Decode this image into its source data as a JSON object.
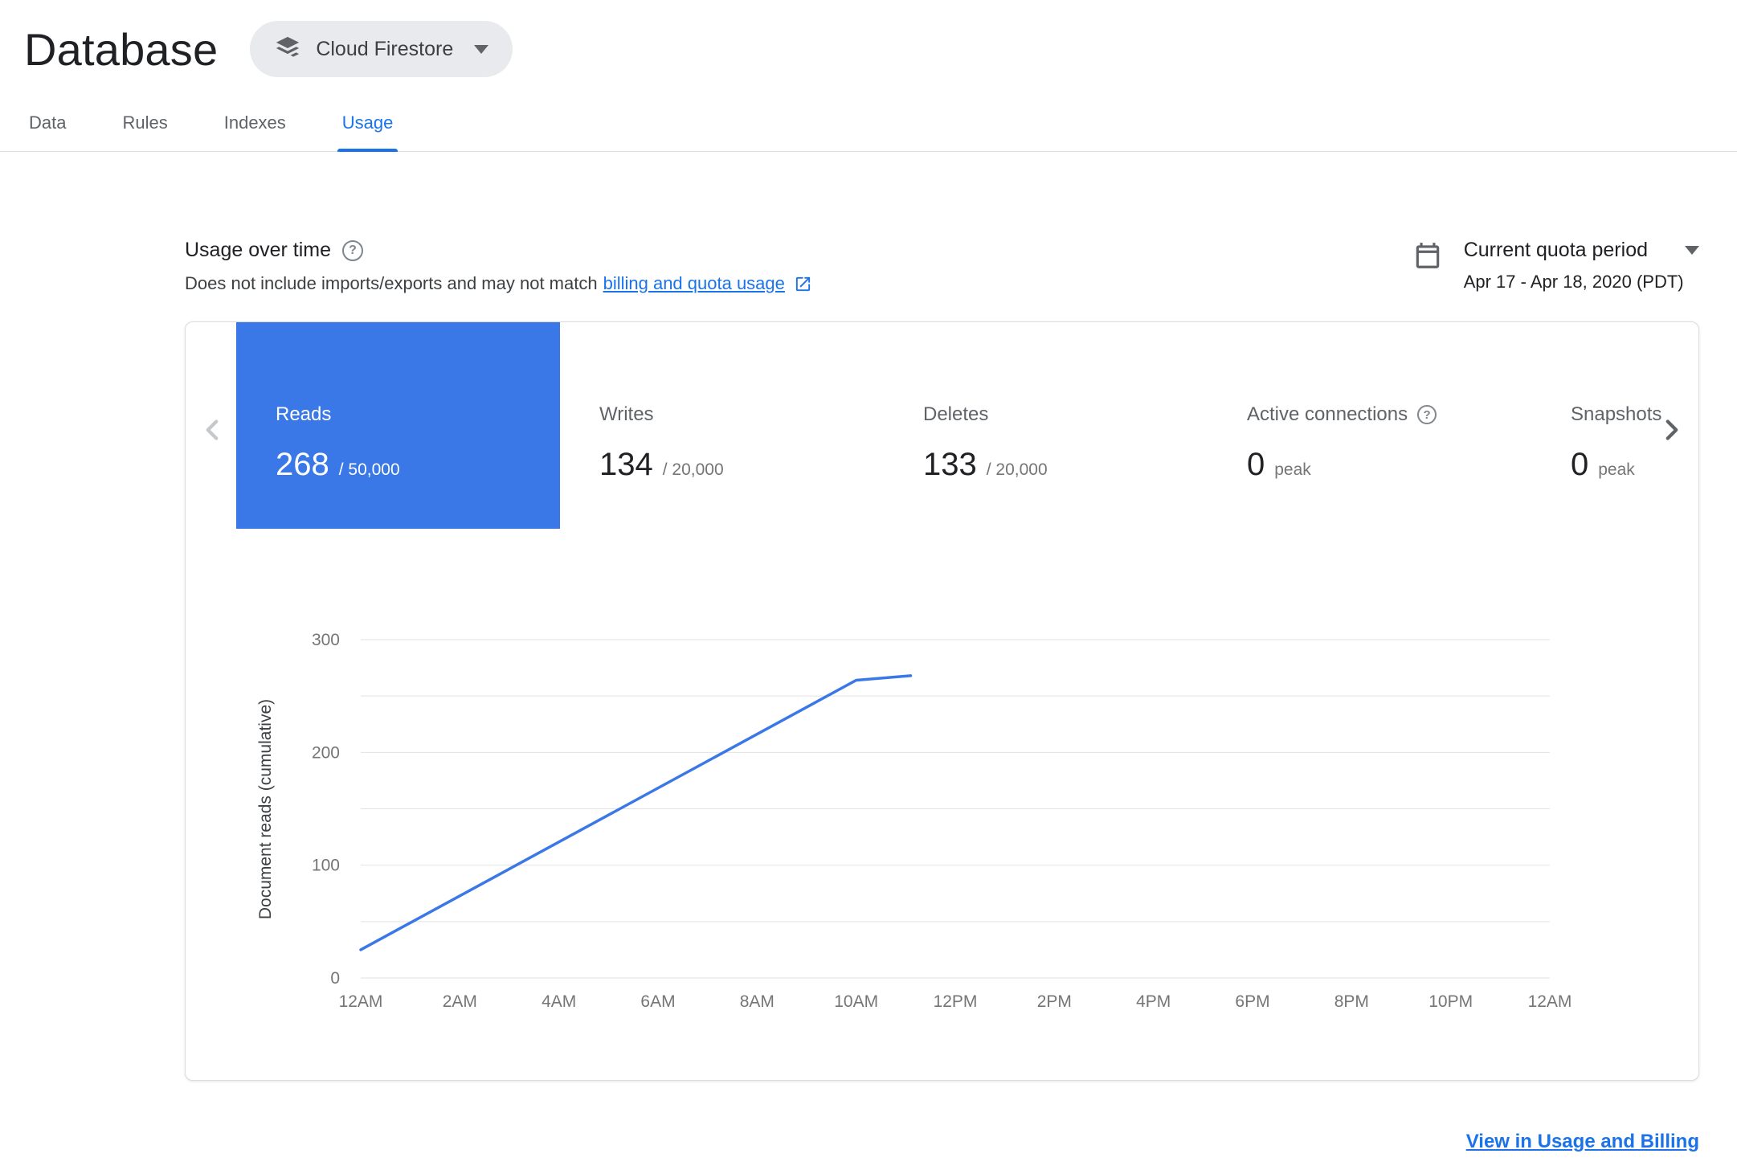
{
  "page": {
    "title": "Database"
  },
  "header": {
    "product_selector": {
      "label": "Cloud Firestore"
    }
  },
  "tabs": [
    {
      "label": "Data",
      "active": false
    },
    {
      "label": "Rules",
      "active": false
    },
    {
      "label": "Indexes",
      "active": false
    },
    {
      "label": "Usage",
      "active": true
    }
  ],
  "usage_section": {
    "title": "Usage over time",
    "description_prefix": "Does not include imports/exports and may not match",
    "description_link": "billing and quota usage",
    "quota_period": {
      "label": "Current quota period",
      "range": "Apr 17 - Apr 18, 2020 (PDT)"
    },
    "metrics": [
      {
        "name": "Reads",
        "value": "268",
        "limit": "/ 50,000",
        "selected": true
      },
      {
        "name": "Writes",
        "value": "134",
        "limit": "/ 20,000",
        "selected": false
      },
      {
        "name": "Deletes",
        "value": "133",
        "limit": "/ 20,000",
        "selected": false
      },
      {
        "name": "Active connections",
        "value": "0",
        "limit": "peak",
        "selected": false,
        "has_help": true
      },
      {
        "name": "Snapshots",
        "value": "0",
        "limit": "peak",
        "selected": false
      }
    ],
    "footer_link": "View in Usage and Billing"
  },
  "icons": {
    "help_glyph": "?"
  },
  "colors": {
    "primary_blue": "#1a73e8",
    "selected_card_blue": "#3b78e7",
    "chart_line_blue": "#3b78e7",
    "grid_gray": "#e2e2e2"
  },
  "chart_data": {
    "type": "line",
    "title": "",
    "xlabel": "",
    "ylabel": "Document reads (cumulative)",
    "x_ticks": [
      "12AM",
      "2AM",
      "4AM",
      "6AM",
      "8AM",
      "10AM",
      "12PM",
      "2PM",
      "4PM",
      "6PM",
      "8PM",
      "10PM",
      "12AM"
    ],
    "x_range": [
      0,
      24
    ],
    "ylim": [
      0,
      300
    ],
    "y_ticks": [
      0,
      100,
      200,
      300
    ],
    "grid_step": 50,
    "grid": true,
    "legend": false,
    "series": [
      {
        "name": "Document reads (cumulative)",
        "color": "#3b78e7",
        "points": [
          {
            "x": 0,
            "y": 25
          },
          {
            "x": 10,
            "y": 264
          },
          {
            "x": 11.1,
            "y": 268
          }
        ]
      }
    ]
  }
}
